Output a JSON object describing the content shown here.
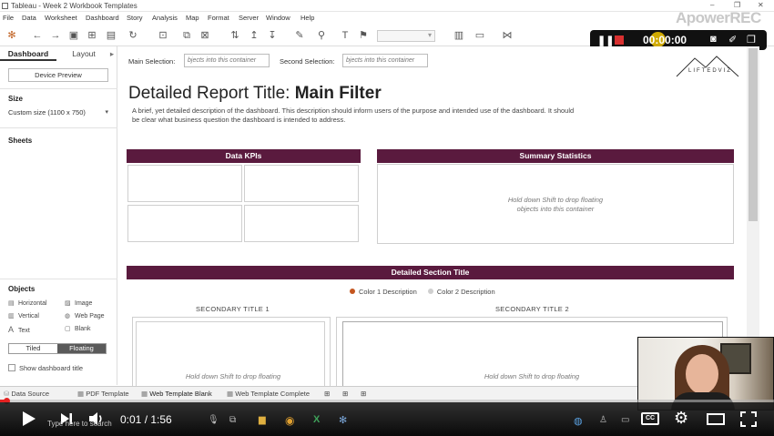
{
  "window": {
    "title": "Tableau - Week 2 Workbook Templates"
  },
  "menu": [
    "File",
    "Data",
    "Worksheet",
    "Dashboard",
    "Story",
    "Analysis",
    "Map",
    "Format",
    "Server",
    "Window",
    "Help"
  ],
  "recorder": {
    "brand": "ApowerREC",
    "time": "00:00:00"
  },
  "left_panel": {
    "tabs": [
      "Dashboard",
      "Layout"
    ],
    "device_preview": "Device Preview",
    "size_heading": "Size",
    "size_value": "Custom size (1100 x 750)",
    "sheets_heading": "Sheets",
    "objects_heading": "Objects",
    "objects": [
      {
        "icon": "horizontal-icon",
        "label": "Horizontal"
      },
      {
        "icon": "image-icon",
        "label": "Image"
      },
      {
        "icon": "vertical-icon",
        "label": "Vertical"
      },
      {
        "icon": "web-page-icon",
        "label": "Web Page"
      },
      {
        "icon": "text-icon",
        "label": "Text"
      },
      {
        "icon": "blank-icon",
        "label": "Blank"
      }
    ],
    "tiled": "Tiled",
    "floating": "Floating",
    "show_title": "Show dashboard title"
  },
  "dashboard": {
    "main_selection_label": "Main Selection:",
    "main_selection_box": "bjects into this container",
    "second_selection_label": "Second Selection:",
    "second_selection_box": "bjects into this container",
    "logo_text": "LIFTEDVIZ",
    "title_prefix": "Detailed Report Title:",
    "title_bold": "Main Filter",
    "description": "A brief, yet detailed description of the dashboard. This description should inform users of the purpose and intended use of the dashboard. It should be clear what business question the dashboard is intended to address.",
    "kpi_header": "Data KPIs",
    "summary_header": "Summary Statistics",
    "summary_hint": "Hold down Shift to drop floating objects into this container",
    "section_header": "Detailed Section Title",
    "legend": [
      {
        "label": "Color 1 Description",
        "color": "#c4561f"
      },
      {
        "label": "Color 2 Description",
        "color": "#cfcfcf"
      }
    ],
    "secondary_title_1": "SECONDARY TITLE 1",
    "secondary_title_2": "SECONDARY TITLE 2",
    "secondary_hint": "Hold down Shift to drop floating"
  },
  "sheet_tabs": [
    "Data Source",
    "PDF Template",
    "Web Template Blank",
    "Web Template Complete"
  ],
  "player": {
    "current": "0:01",
    "duration": "1:56",
    "time_display": "0:01 / 1:56",
    "taskbar_search": "Type here to search",
    "progress": 0.0086,
    "accent": "#e52222"
  },
  "colors": {
    "header_bg": "#5a1a3e"
  }
}
